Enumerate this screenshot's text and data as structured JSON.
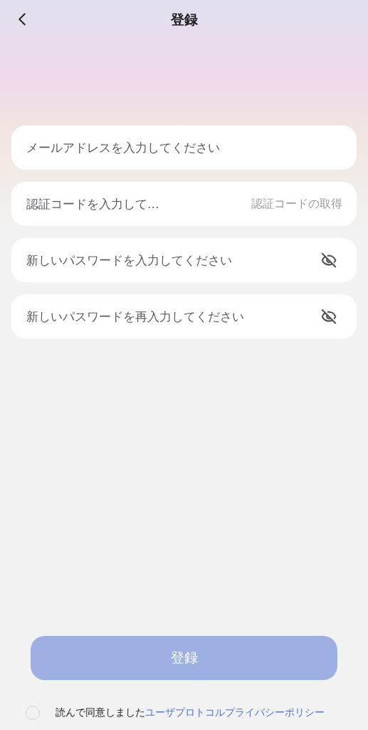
{
  "header": {
    "title": "登録"
  },
  "fields": [
    {
      "kind": "email",
      "placeholder": "メールアドレスを入力してください"
    },
    {
      "kind": "code",
      "placeholder": "認証コードを入力して…",
      "action": "認証コードの取得"
    },
    {
      "kind": "password",
      "placeholder": "新しいパスワードを入力してください",
      "visible": false
    },
    {
      "kind": "password",
      "placeholder": "新しいパスワードを再入力してください",
      "visible": false
    }
  ],
  "submit": {
    "label": "登録",
    "disabled": true
  },
  "agreement": {
    "checked": false,
    "text": "読んで同意しました",
    "links": [
      "ユーザプロトコル",
      "プライバシーポリシー"
    ]
  }
}
